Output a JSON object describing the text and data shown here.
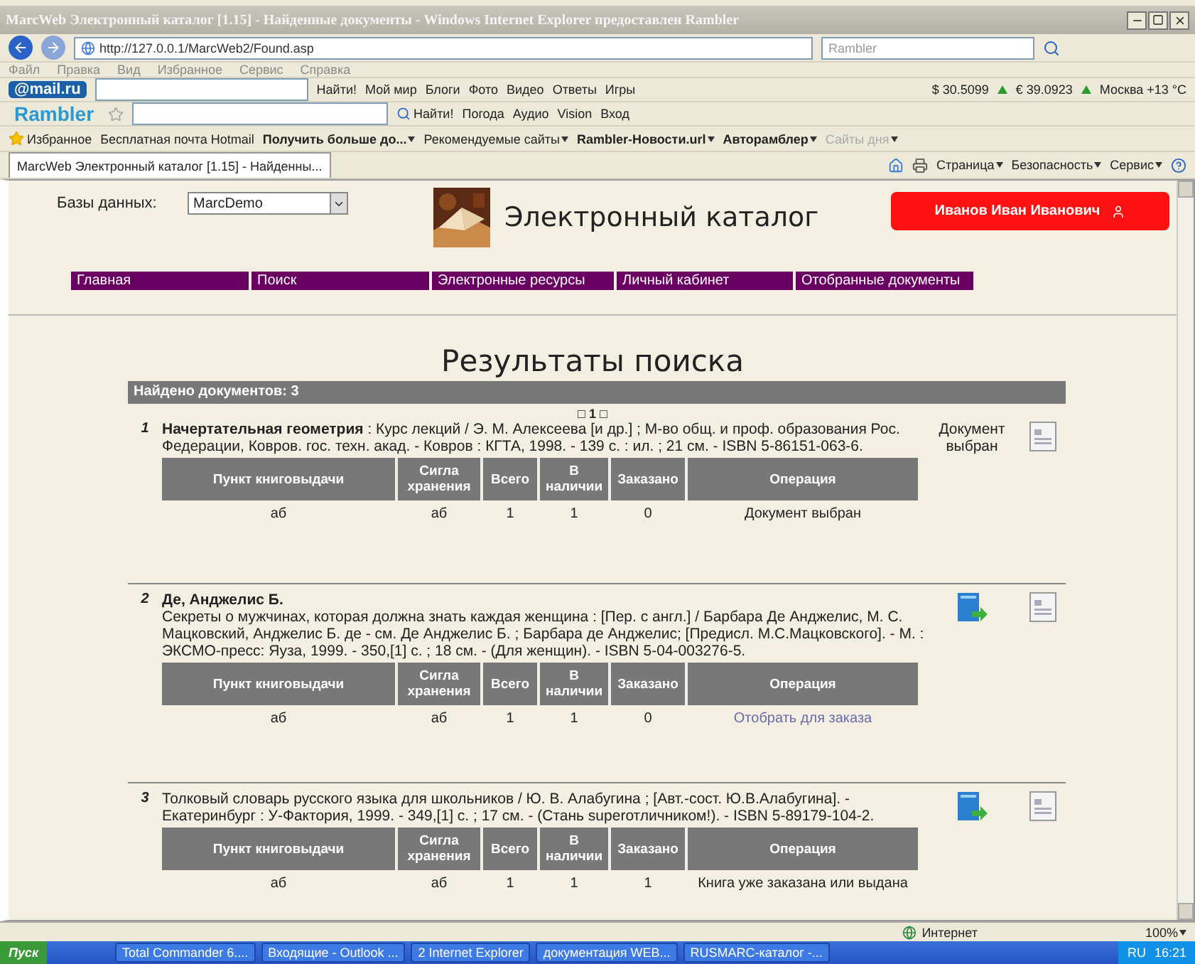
{
  "window": {
    "title": "MarcWeb Электронный каталог [1.15] - Найденные документы - Windows Internet Explorer предоставлен Rambler"
  },
  "address_bar": {
    "url": "http://127.0.0.1/MarcWeb2/Found.asp",
    "search_placeholder": "Rambler"
  },
  "menu": [
    "Файл",
    "Правка",
    "Вид",
    "Избранное",
    "Сервис",
    "Справка"
  ],
  "mail_toolbar": {
    "logo": "@mail.ru",
    "button": "Найти!",
    "links": [
      "Мой мир",
      "Блоги",
      "Фото",
      "Видео",
      "Ответы",
      "Игры"
    ],
    "rates": [
      "$ 30.5099",
      "€ 39.0923"
    ],
    "weather": "Москва +13 °C"
  },
  "rambler_toolbar": {
    "logo": "Rambler",
    "button": "Найти!",
    "links": [
      "Погода",
      "Аудио",
      "Vision",
      "Вход"
    ]
  },
  "favorites_bar": {
    "label": "Избранное",
    "links": [
      {
        "text": "Бесплатная почта Hotmail",
        "bold": false,
        "dropdown": false
      },
      {
        "text": "Получить больше до...",
        "bold": true,
        "dropdown": true
      },
      {
        "text": "Рекомендуемые сайты",
        "bold": false,
        "dropdown": true
      },
      {
        "text": "Rambler-Новости.url",
        "bold": true,
        "dropdown": true
      },
      {
        "text": "Авторамблер",
        "bold": true,
        "dropdown": true
      },
      {
        "text": "Сайты дня",
        "bold": false,
        "dropdown": true,
        "disabled": true
      }
    ]
  },
  "tabs": [
    {
      "label": "MarcWeb Электронный каталог [1.15] - Найденны...",
      "selected": true
    }
  ],
  "command_bar": [
    "Страница",
    "Безопасность",
    "Сервис"
  ],
  "page": {
    "db_label": "Базы данных:",
    "db_value": "MarcDemo",
    "site_title": "Электронный каталог",
    "user_name": "Иванов Иван Иванович",
    "nav": [
      "Главная",
      "Поиск",
      "Электронные ресурсы",
      "Личный кабинет",
      "Отобранные документы"
    ],
    "heading": "Результаты поиска",
    "found": "Найдено документов: 3",
    "pager": {
      "prev": "□",
      "current": "1",
      "next": "□"
    },
    "records": [
      {
        "number": "1",
        "text": "**Начертательная геометрия** : Курс лекций / Э. М. Алексеева [и др.] ; М-во общ. и проф. образования Рос. Федерации, Ковров. гос. техн. акад. - Ковров : КГТА, 1998. - 139 с. : ил. ; 21 см. - ISBN 5-86151-063-6.",
        "action": {
          "kind": "status",
          "text": "Документ выбран"
        },
        "columns": [
          "Пункт книговыдачи",
          "Сигла хранения",
          "Всего",
          "В наличии",
          "Заказано",
          "Операция"
        ],
        "rows": [
          {
            "cells": [
              "аб",
              "аб",
              "1",
              "1",
              "0"
            ],
            "operation": {
              "text": "Документ выбран",
              "link": false
            }
          }
        ]
      },
      {
        "number": "2",
        "author": "Де, Анджелис Б.",
        "text": "Секреты о мужчинах, которая должна знать каждая женщина : [Пер. с англ.] / Барбара Де Анджелис, М. С. Мацковский, Анджелис Б. де - см. Де Анджелис Б. ; Барбара де Анджелис; [Предисл. М.С.Мацковского]. - М. : ЭКСМО-пресс: Яуза, 1999. - 350,[1] с. ; 18 см. - (Для женщин). - ISBN 5-04-003276-5.",
        "action": {
          "kind": "order_icon"
        },
        "columns": [
          "Пункт книговыдачи",
          "Сигла хранения",
          "Всего",
          "В наличии",
          "Заказано",
          "Операция"
        ],
        "rows": [
          {
            "cells": [
              "аб",
              "аб",
              "1",
              "1",
              "0"
            ],
            "operation": {
              "text": "Отобрать для заказа",
              "link": true
            }
          }
        ]
      },
      {
        "number": "3",
        "text": "Толковый словарь русского языка для школьников / Ю. В. Алабугина ; [Авт.-сост. Ю.В.Алабугина]. - Екатеринбург : У-Фактория, 1999. - 349,[1] с. ; 17 см. - (Стань superотличником!). - ISBN 5-89179-104-2.",
        "action": {
          "kind": "order_icon"
        },
        "columns": [
          "Пункт книговыдачи",
          "Сигла хранения",
          "Всего",
          "В наличии",
          "Заказано",
          "Операция"
        ],
        "rows": [
          {
            "cells": [
              "аб",
              "аб",
              "1",
              "1",
              "1"
            ],
            "operation": {
              "text": "Книга уже заказана или выдана",
              "link": false
            }
          }
        ]
      }
    ]
  },
  "status_bar": {
    "zone": "Интернет",
    "zoom": "100%"
  },
  "taskbar": {
    "start": "Пуск",
    "items": [
      "Total Commander 6....",
      "Входящие - Outlook ...",
      "2 Internet Explorer",
      "документация WEB...",
      "RUSMARC-каталог -..."
    ],
    "language": "RU",
    "clock": "16:21"
  }
}
